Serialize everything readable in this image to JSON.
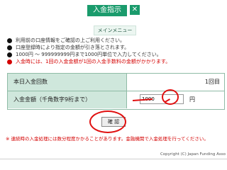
{
  "header": {
    "title": "入金指示",
    "icon": "close-icon",
    "menu_label": "メインメニュー"
  },
  "notes": [
    {
      "text": "利用前の口座情報をご確認の上ご利用ください。",
      "red": false
    },
    {
      "text": "口座登録時により指定の金額が引き落とされます。",
      "red": false
    },
    {
      "text": "1000円 〜 999999999円まで1000円単位で入力してください。",
      "red": false
    },
    {
      "text": "入金時には、1回の入金金額が1回の入金手数料の金額がかかります。",
      "red": true
    }
  ],
  "form": {
    "row1_label": "本日入金回数",
    "row1_value": "1回目",
    "row2_label": "入金金額（千角数字9桁まで）",
    "amount_value": "1000",
    "currency": "円"
  },
  "buttons": {
    "next_label": "確 認"
  },
  "footer": {
    "note": "※ 連続時の入金処理には数分程度かかることがあります。金融機関で入金処理を行ってください。",
    "copyright": "Copyright (C) Japan Funding Asso"
  },
  "colors": {
    "header_bg": "#1a9b6c",
    "label_bg": "#cfe7dc",
    "annotation": "#e01010",
    "warning_text": "#d40000"
  }
}
